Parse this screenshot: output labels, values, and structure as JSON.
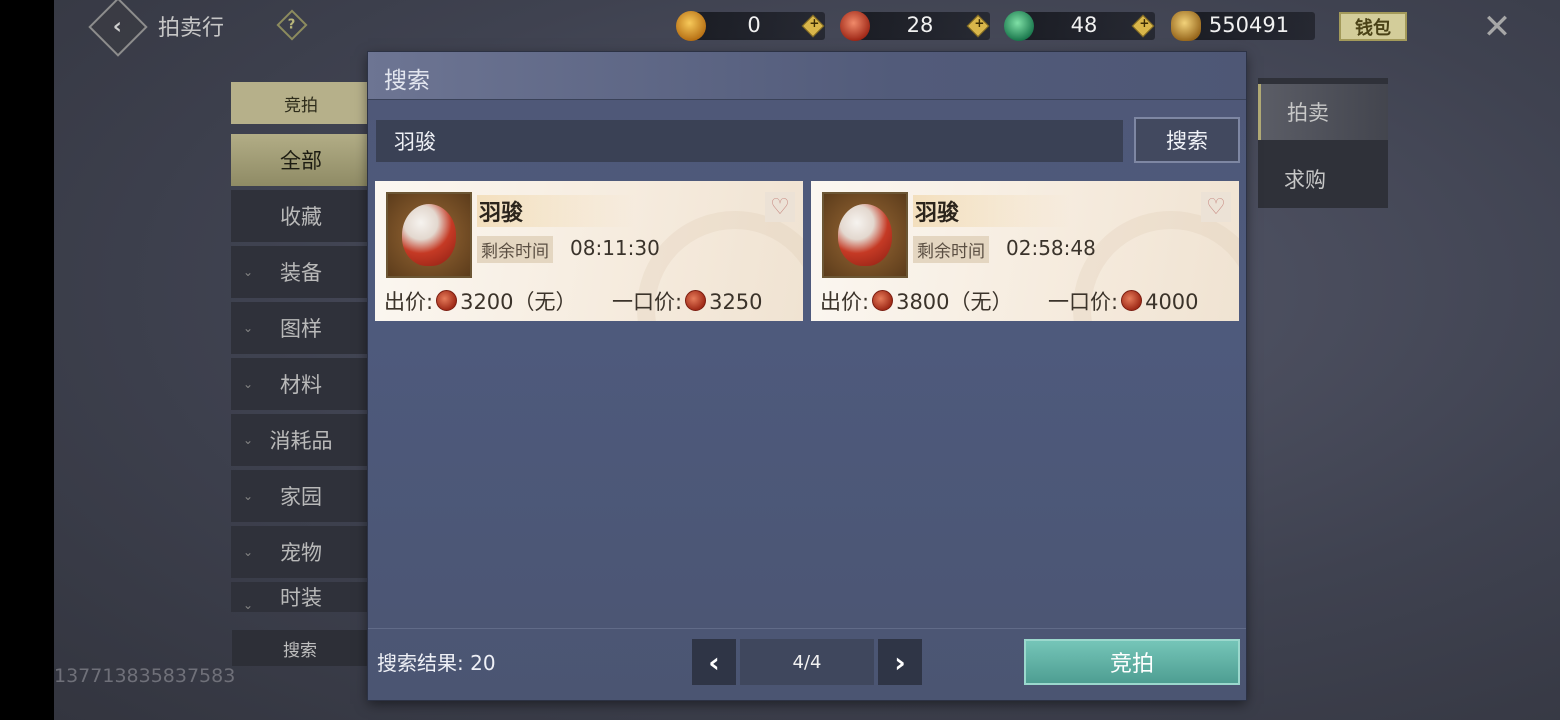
{
  "header": {
    "title": "拍卖行",
    "help_glyph": "?",
    "currencies": [
      {
        "icon": "gold-gourd-icon",
        "value": "0",
        "color": "#e4a23a"
      },
      {
        "icon": "red-swirl-coin-icon",
        "value": "28",
        "color": "#c8402b"
      },
      {
        "icon": "jade-coin-icon",
        "value": "48",
        "color": "#2fa86a"
      },
      {
        "icon": "gold-leaf-coin-icon",
        "value": "550491",
        "color": "#c99c3f"
      }
    ],
    "wallet_label": "钱包"
  },
  "left_nav": {
    "tab_label": "竞拍",
    "categories": [
      {
        "label": "全部",
        "active": true,
        "expandable": false
      },
      {
        "label": "收藏",
        "active": false,
        "expandable": false
      },
      {
        "label": "装备",
        "active": false,
        "expandable": true
      },
      {
        "label": "图样",
        "active": false,
        "expandable": true
      },
      {
        "label": "材料",
        "active": false,
        "expandable": true
      },
      {
        "label": "消耗品",
        "active": false,
        "expandable": true
      },
      {
        "label": "家园",
        "active": false,
        "expandable": true
      },
      {
        "label": "宠物",
        "active": false,
        "expandable": true
      },
      {
        "label": "时装",
        "active": false,
        "expandable": true
      }
    ],
    "search_label": "搜索"
  },
  "user_id": "137713835837583",
  "right_tabs": [
    {
      "label": "拍卖",
      "active": true
    },
    {
      "label": "求购",
      "active": false
    }
  ],
  "modal": {
    "title": "搜索",
    "search_value": "羽骏",
    "search_button": "搜索",
    "results": [
      {
        "name": "羽骏",
        "time_label": "剩余时间",
        "time_left": "08:11:30",
        "bid_label": "出价:",
        "bid_price": "3200",
        "bid_note": "（无）",
        "buyout_label": "一口价:",
        "buyout_price": "3250"
      },
      {
        "name": "羽骏",
        "time_label": "剩余时间",
        "time_left": "02:58:48",
        "bid_label": "出价:",
        "bid_price": "3800",
        "bid_note": "（无）",
        "buyout_label": "一口价:",
        "buyout_price": "4000"
      }
    ],
    "result_label": "搜索结果:",
    "result_count": "20",
    "page": "4/4",
    "bid_button": "竞拍"
  }
}
